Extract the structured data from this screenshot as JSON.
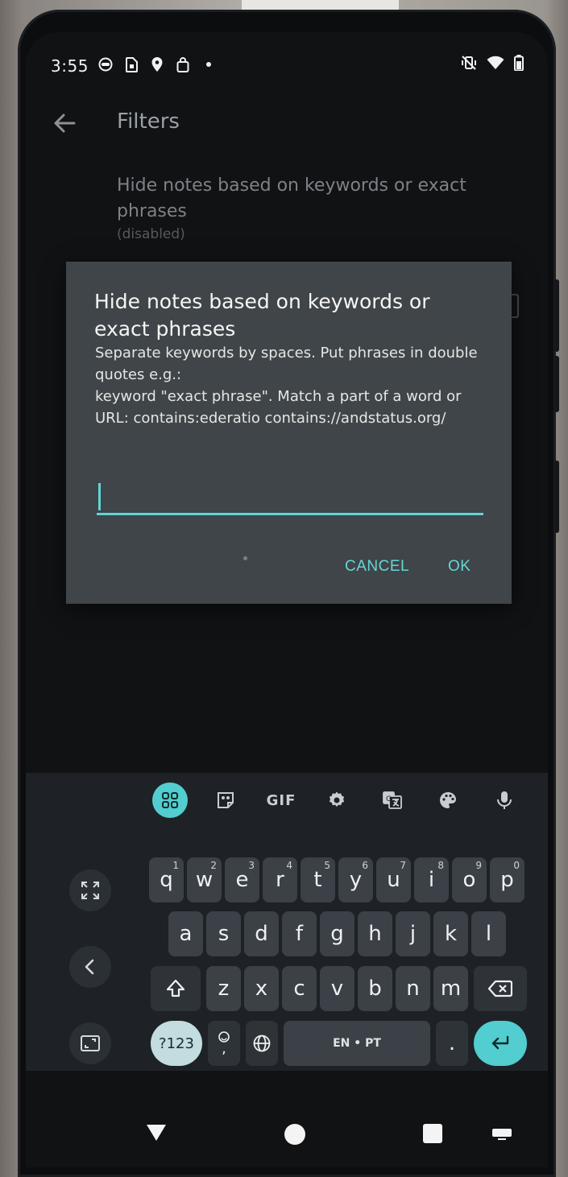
{
  "status_bar": {
    "time": "3:55",
    "left_icons": [
      "face-icon",
      "sim-icon",
      "location-icon",
      "bag-icon",
      "dot-icon"
    ],
    "right_icons": [
      "vibrate-off-icon",
      "wifi-icon",
      "battery-icon"
    ]
  },
  "app_bar": {
    "title": "Filters"
  },
  "preference": {
    "title": "Hide notes based on keywords or exact phrases",
    "summary": "(disabled)"
  },
  "dialog": {
    "title": "Hide notes based on keywords or exact phrases",
    "message_line1": "Separate keywords by spaces. Put phrases in double quotes e.g.:",
    "message_line2": "keyword \"exact phrase\". Match a part of a word or URL: contains:ederatio contains://andstatus.org/",
    "input_value": "",
    "cancel_label": "CANCEL",
    "ok_label": "OK"
  },
  "keyboard": {
    "toolbar": [
      "apps-grid-icon",
      "sticker-icon",
      "GIF",
      "settings-icon",
      "translate-icon",
      "palette-icon",
      "mic-icon"
    ],
    "gif_label": "GIF",
    "row1": [
      {
        "k": "q",
        "h": "1"
      },
      {
        "k": "w",
        "h": "2"
      },
      {
        "k": "e",
        "h": "3"
      },
      {
        "k": "r",
        "h": "4"
      },
      {
        "k": "t",
        "h": "5"
      },
      {
        "k": "y",
        "h": "6"
      },
      {
        "k": "u",
        "h": "7"
      },
      {
        "k": "i",
        "h": "8"
      },
      {
        "k": "o",
        "h": "9"
      },
      {
        "k": "p",
        "h": "0"
      }
    ],
    "row2": [
      "a",
      "s",
      "d",
      "f",
      "g",
      "h",
      "j",
      "k",
      "l"
    ],
    "row3": [
      "z",
      "x",
      "c",
      "v",
      "b",
      "n",
      "m"
    ],
    "symbols_label": "?123",
    "space_label": "EN • PT",
    "period_label": ".",
    "emoji_comma_label": ","
  },
  "colors": {
    "accent": "#52cdd0",
    "dialog_bg": "#3f4548",
    "keyboard_bg": "#1e2227",
    "key_bg": "#3b4146"
  }
}
